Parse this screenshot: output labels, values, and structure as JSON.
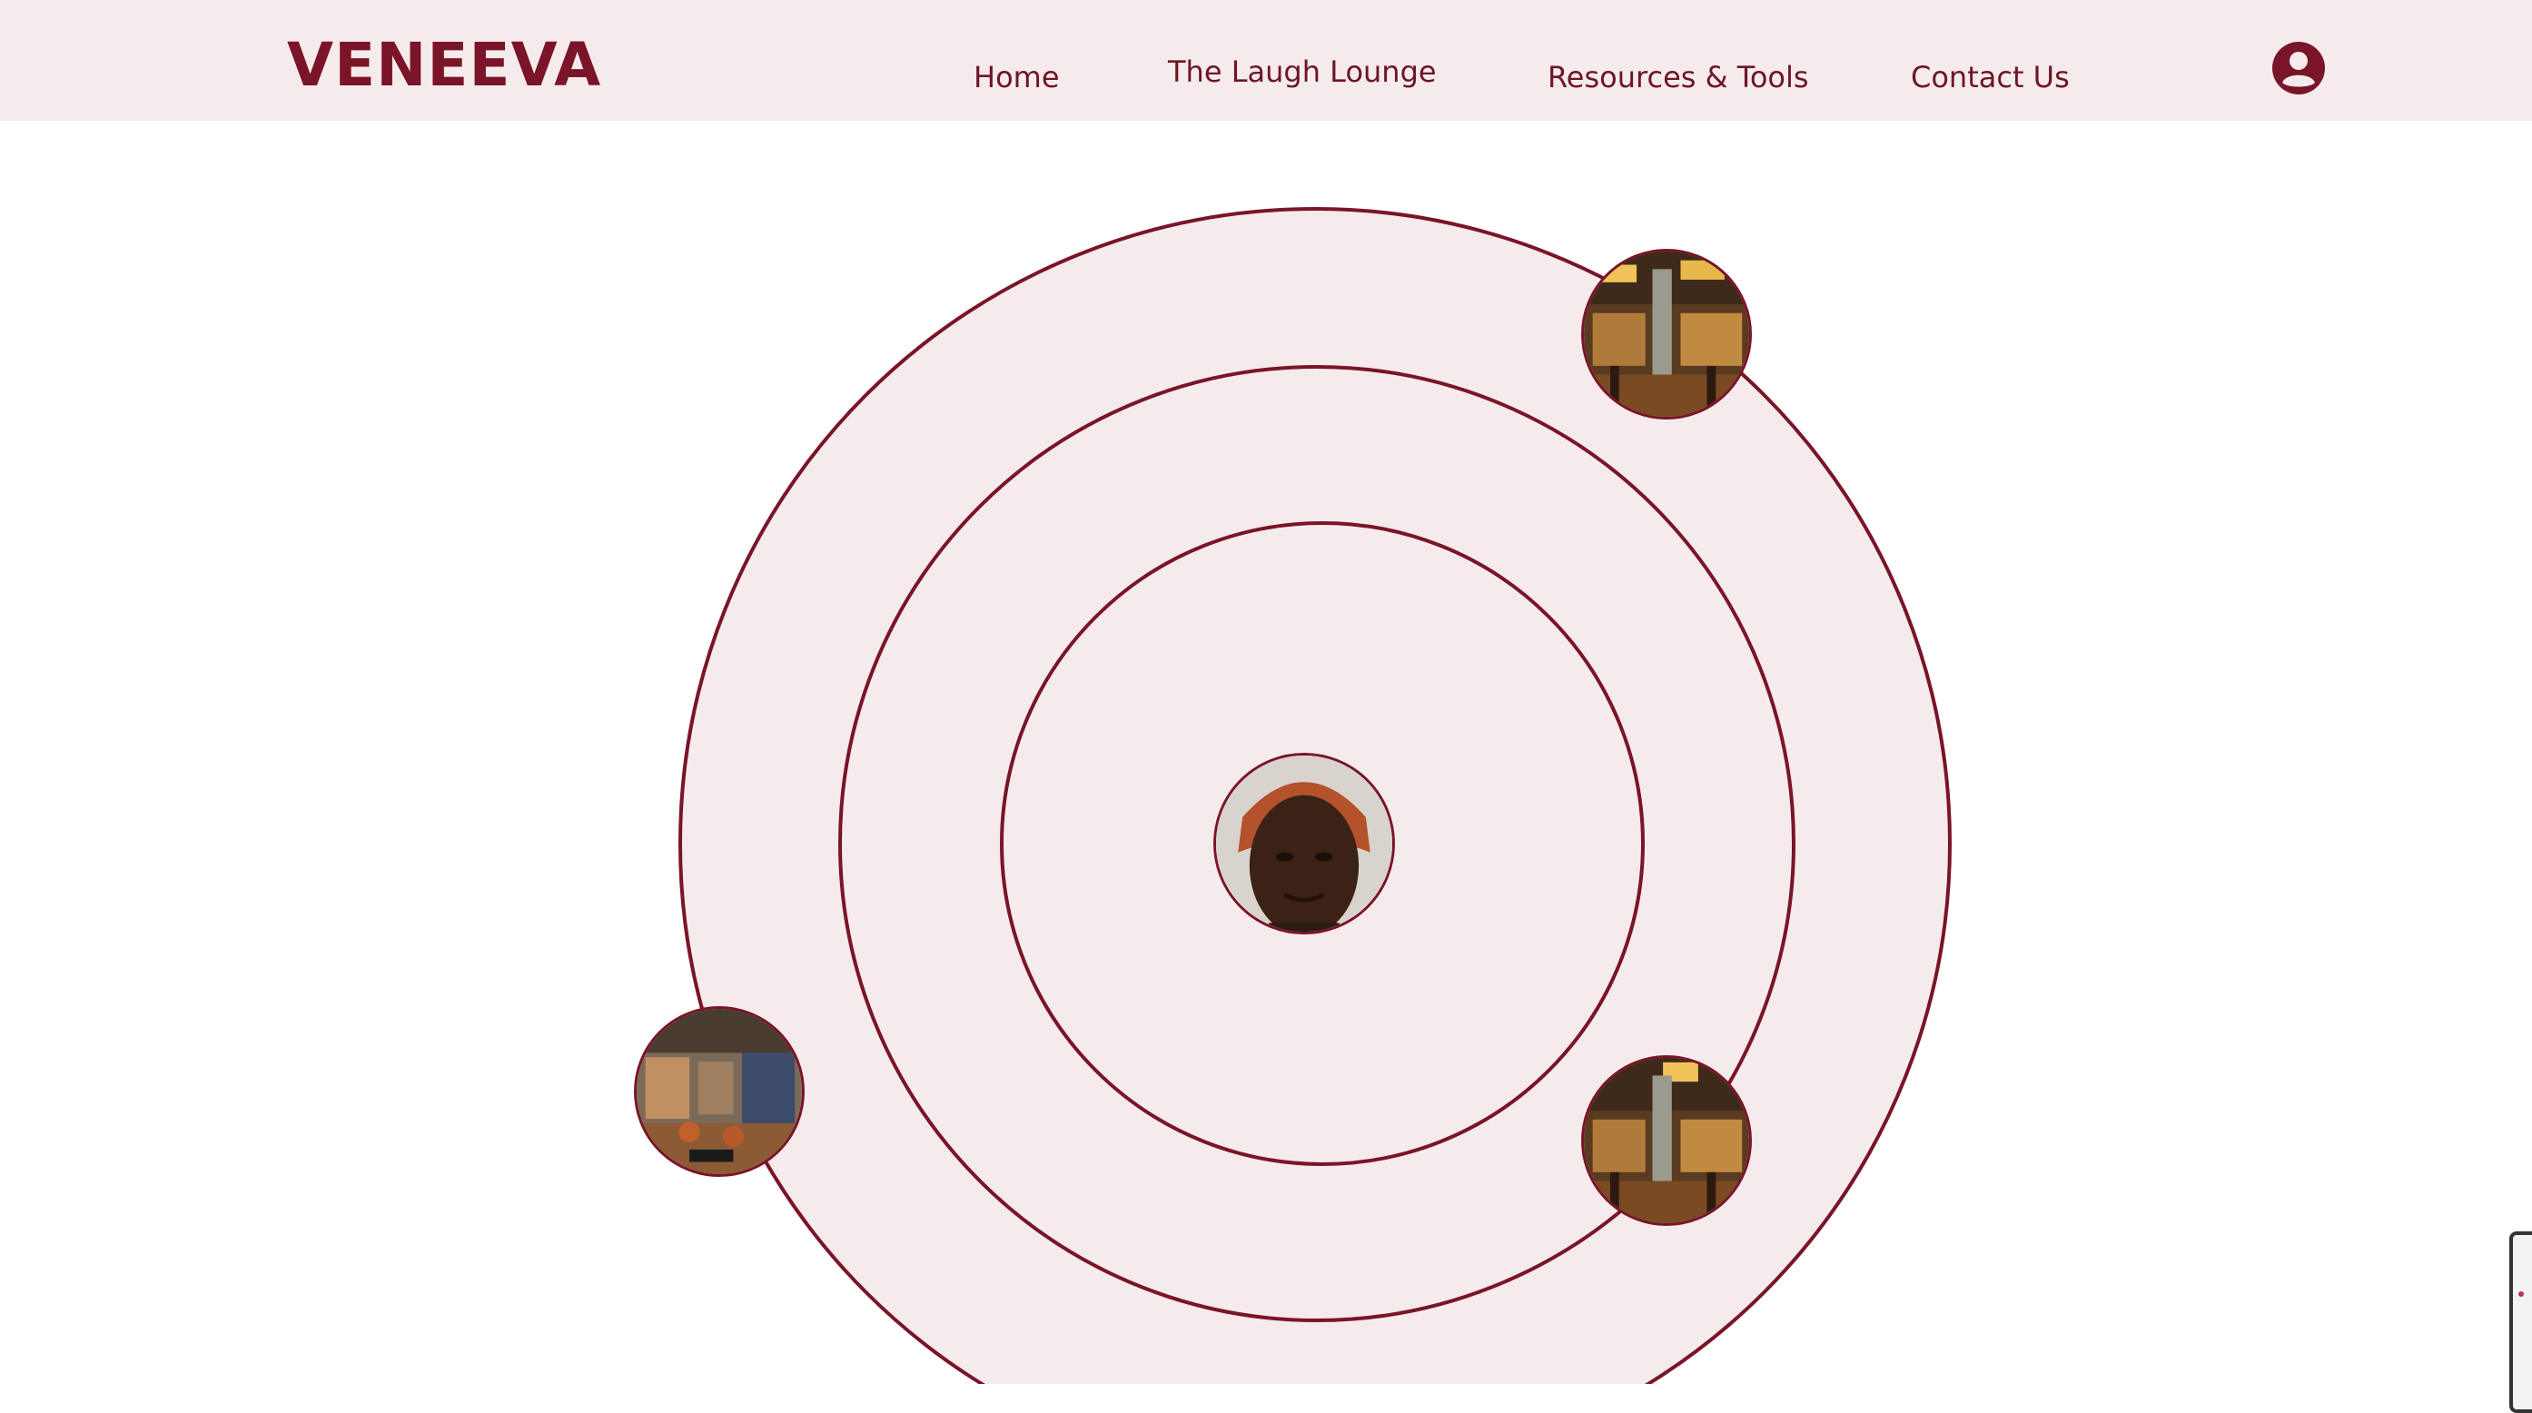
{
  "brand": {
    "logo": "VENEEVA"
  },
  "nav": {
    "home": "Home",
    "laugh_lounge": "The Laugh Lounge",
    "resources": "Resources & Tools",
    "contact": "Contact Us"
  },
  "icons": {
    "profile": "user-circle-icon"
  },
  "colors": {
    "brand": "#7a1428",
    "header_bg": "#f5ebec",
    "ring_fill": "#f5ebec"
  }
}
